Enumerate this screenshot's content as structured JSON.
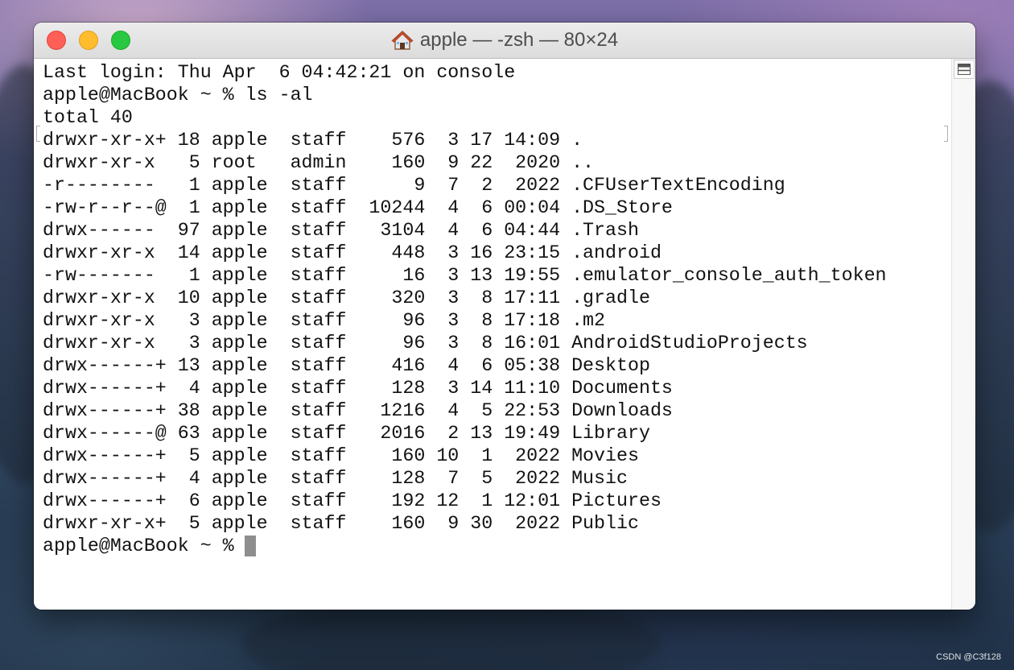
{
  "window": {
    "title": "apple — -zsh — 80×24",
    "title_icon": "house-icon",
    "buttons": {
      "close": {
        "icon": "close-icon",
        "color": "#fe5f57"
      },
      "minimize": {
        "icon": "minimize-icon",
        "color": "#febc2e"
      },
      "zoom": {
        "icon": "zoom-icon",
        "color": "#28c840"
      }
    }
  },
  "terminal": {
    "lines": [
      "Last login: Thu Apr  6 04:42:21 on console",
      "apple@MacBook ~ % ls -al",
      "total 40",
      "drwxr-xr-x+ 18 apple  staff    576  3 17 14:09 .",
      "drwxr-xr-x   5 root   admin    160  9 22  2020 ..",
      "-r--------   1 apple  staff      9  7  2  2022 .CFUserTextEncoding",
      "-rw-r--r--@  1 apple  staff  10244  4  6 00:04 .DS_Store",
      "drwx------  97 apple  staff   3104  4  6 04:44 .Trash",
      "drwxr-xr-x  14 apple  staff    448  3 16 23:15 .android",
      "-rw-------   1 apple  staff     16  3 13 19:55 .emulator_console_auth_token",
      "drwxr-xr-x  10 apple  staff    320  3  8 17:11 .gradle",
      "drwxr-xr-x   3 apple  staff     96  3  8 17:18 .m2",
      "drwxr-xr-x   3 apple  staff     96  3  8 16:01 AndroidStudioProjects",
      "drwx------+ 13 apple  staff    416  4  6 05:38 Desktop",
      "drwx------+  4 apple  staff    128  3 14 11:10 Documents",
      "drwx------+ 38 apple  staff   1216  4  5 22:53 Downloads",
      "drwx------@ 63 apple  staff   2016  2 13 19:49 Library",
      "drwx------+  5 apple  staff    160 10  1  2022 Movies",
      "drwx------+  4 apple  staff    128  7  5  2022 Music",
      "drwx------+  6 apple  staff    192 12  1 12:01 Pictures",
      "drwxr-xr-x+  5 apple  staff    160  9 30  2022 Public",
      "apple@MacBook ~ % "
    ],
    "text_color": "#111111",
    "background": "#ffffff",
    "cursor_color": "#8e8e8e"
  },
  "scrollbar": {
    "split_button_icon": "split-pane-icon"
  },
  "watermark": "CSDN @C3f128"
}
